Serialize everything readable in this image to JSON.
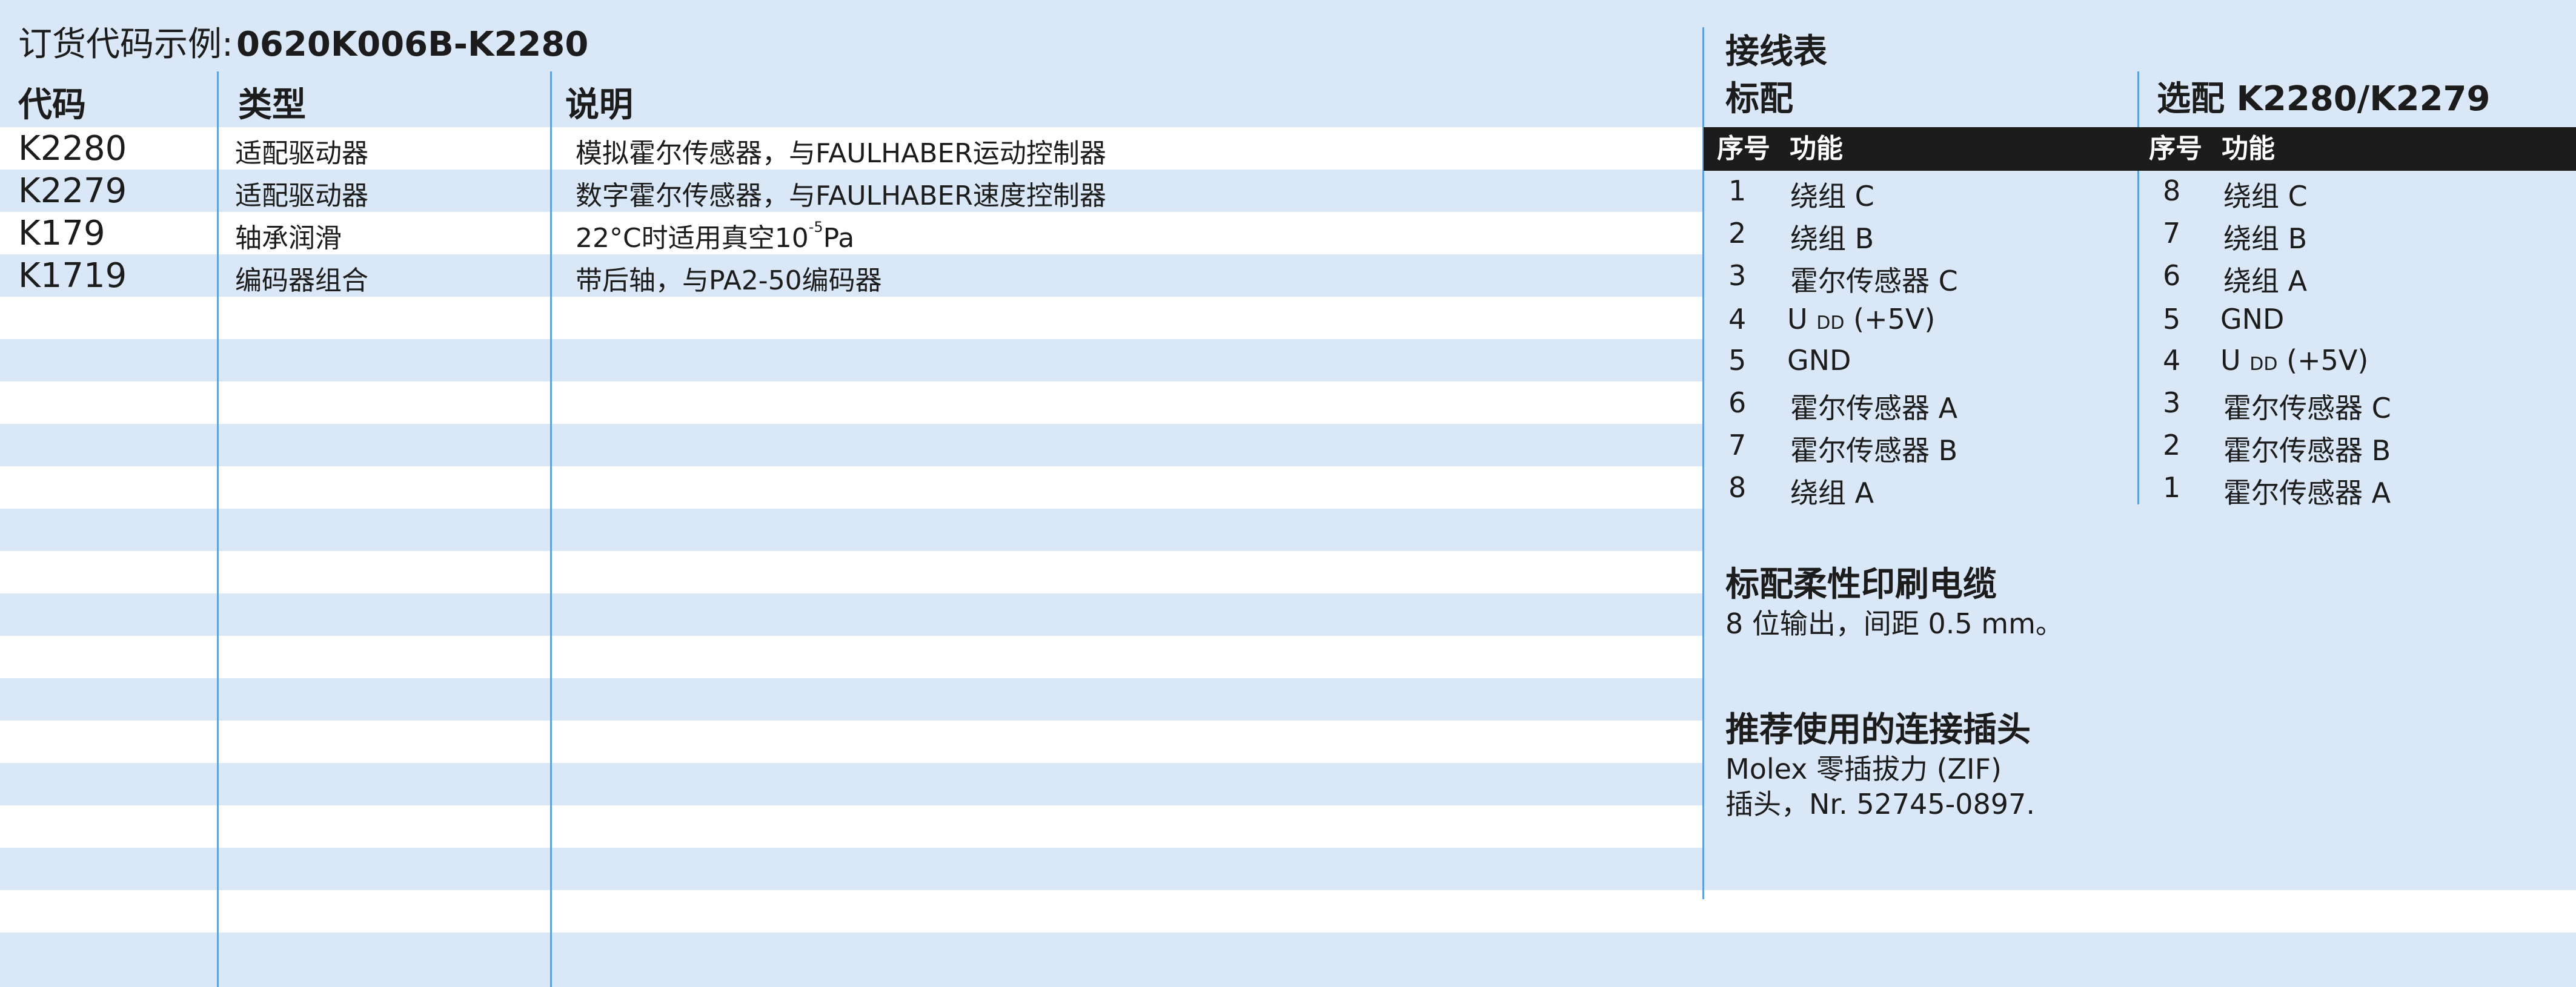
{
  "order_example": {
    "prefix": "订货代码示例:",
    "code": "0620K006B-K2280"
  },
  "option_table": {
    "headers": {
      "code": "代码",
      "type": "类型",
      "desc": "说明"
    },
    "rows": [
      {
        "code": "K2280",
        "type": "适配驱动器",
        "desc": "模拟霍尔传感器，与FAULHABER运动控制器"
      },
      {
        "code": "K2279",
        "type": "适配驱动器",
        "desc": "数字霍尔传感器，与FAULHABER速度控制器"
      },
      {
        "code": "K179",
        "type": "轴承润滑",
        "desc": "22°C时适用真空10",
        "desc_sup": "-5",
        "desc_suffix": "Pa"
      },
      {
        "code": "K1719",
        "type": "编码器组合",
        "desc": "带后轴，与PA2-50编码器"
      }
    ]
  },
  "wiring": {
    "title": "接线表",
    "standard_label": "标配",
    "option_label": "选配 K2280/K2279",
    "col_no": "序号",
    "col_func": "功能",
    "standard": [
      {
        "no": "1",
        "func": "绕组 C"
      },
      {
        "no": "2",
        "func": "绕组 B"
      },
      {
        "no": "3",
        "func": "霍尔传感器 C"
      },
      {
        "no": "4",
        "func": "U",
        "sub": "DD",
        "suffix": "(+5V)"
      },
      {
        "no": "5",
        "func": "GND"
      },
      {
        "no": "6",
        "func": "霍尔传感器 A"
      },
      {
        "no": "7",
        "func": "霍尔传感器 B"
      },
      {
        "no": "8",
        "func": "绕组 A"
      }
    ],
    "option": [
      {
        "no": "8",
        "func": "绕组 C"
      },
      {
        "no": "7",
        "func": "绕组 B"
      },
      {
        "no": "6",
        "func": "绕组 A"
      },
      {
        "no": "5",
        "func": "GND"
      },
      {
        "no": "4",
        "func": "U",
        "sub": "DD",
        "suffix": "(+5V)"
      },
      {
        "no": "3",
        "func": "霍尔传感器 C"
      },
      {
        "no": "2",
        "func": "霍尔传感器 B"
      },
      {
        "no": "1",
        "func": "霍尔传感器 A"
      }
    ]
  },
  "cable": {
    "title": "标配柔性印刷电缆",
    "text": "8 位输出，间距 0.5 mm。"
  },
  "connector": {
    "title": "推荐使用的连接插头",
    "line1": "Molex 零插拔力 (ZIF)",
    "line2": "插头，Nr. 52745-0897."
  },
  "colors": {
    "background": "#d9e7f6",
    "stripe": "#ffffff",
    "divider": "#5ea2d6",
    "header_bar": "#1c1c1c"
  }
}
